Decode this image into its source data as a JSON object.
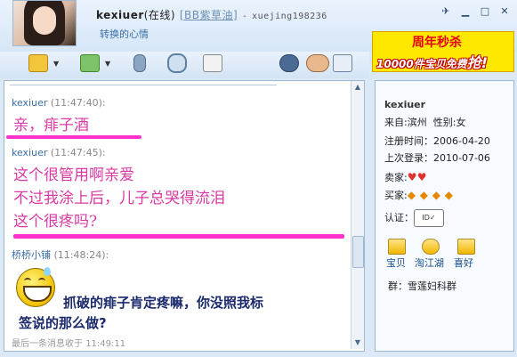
{
  "header": {
    "nickname": "kexiuer",
    "status": "(在线)",
    "link_text": "[BB紫草油]",
    "separator": "-",
    "account": "xuejing198236",
    "mood": "转换的心情"
  },
  "window_buttons": [
    "pin-icon",
    "minimize-icon",
    "maximize-icon",
    "close-icon"
  ],
  "ad": {
    "line1": "周年秒杀",
    "line2": "10000件宝贝免费",
    "line2_big": "抢!"
  },
  "chat": {
    "messages": [
      {
        "sender": "kexiuer",
        "time": "(11:47:40):",
        "lines": [
          "亲，痱子酒"
        ]
      },
      {
        "sender": "kexiuer",
        "time": "(11:47:45):",
        "lines": [
          "这个很管用啊亲爱",
          "不过我涂上后，儿子总哭得流泪",
          "这个很疼吗?"
        ]
      },
      {
        "sender": "桥桥小铺",
        "time": "(11:48:24):",
        "lines": [
          "抓破的痱子肯定疼嘛，你没照我标",
          "签说的那么做?"
        ]
      }
    ],
    "last_message": "最后一条消息收于",
    "last_time": "11:49:11"
  },
  "profile": {
    "username": "kexiuer",
    "from_label": "来自:",
    "from_value": "滨州",
    "gender_label": "性别:",
    "gender_value": "女",
    "reg_label": "注册时间：",
    "reg_value": "2006-04-20",
    "login_label": "上次登录：",
    "login_value": "2010-07-06",
    "seller_label": "卖家:",
    "buyer_label": "买家:",
    "verify_label": "认证：",
    "links": [
      "宝贝",
      "淘江湖",
      "喜好"
    ],
    "group": "群：雪莲妇科群"
  },
  "colors": {
    "pink_text": "#d93aa3",
    "reply_text": "#1b2a6b",
    "sender": "#3b6ea5"
  }
}
